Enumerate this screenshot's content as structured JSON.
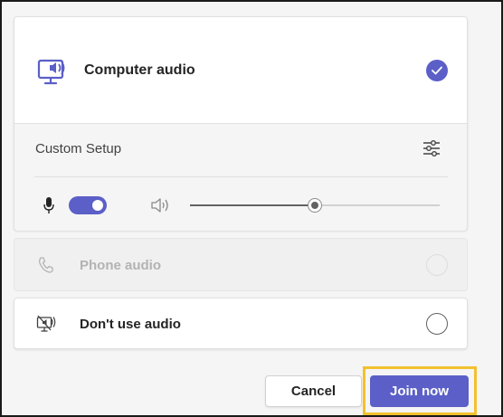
{
  "audio_options": {
    "computer": {
      "label": "Computer audio",
      "selected": true,
      "icon": "monitor-speaker-icon"
    },
    "custom_setup": {
      "label": "Custom Setup",
      "settings_icon": "sliders-icon",
      "mic_icon": "microphone-icon",
      "mic_on": true,
      "speaker_icon": "speaker-icon",
      "volume_fraction": 0.5
    },
    "phone": {
      "label": "Phone audio",
      "disabled": true,
      "icon": "phone-icon"
    },
    "none": {
      "label": "Don't use audio",
      "selected": false,
      "icon": "monitor-speaker-off-icon"
    }
  },
  "actions": {
    "cancel_label": "Cancel",
    "join_label": "Join now"
  },
  "colors": {
    "accent": "#5b5fc7",
    "highlight": "#f2c12e"
  }
}
